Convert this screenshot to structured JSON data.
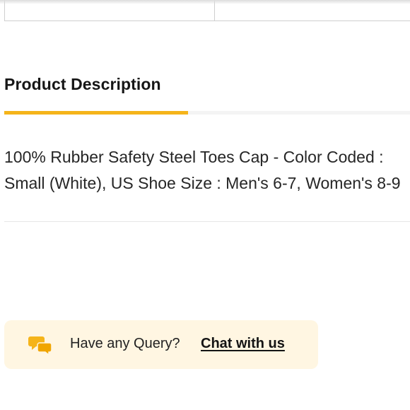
{
  "section": {
    "title": "Product Description"
  },
  "description": {
    "text": "100% Rubber Safety Steel Toes Cap - Color Coded : Small (White), US Shoe Size : Men's 6-7, Women's 8-9"
  },
  "query": {
    "prompt": "Have any Query?",
    "link_label": "Chat with us",
    "icon": "chat-bubbles-icon"
  },
  "colors": {
    "accent": "#f5b41a",
    "query_bg": "#fff6e2"
  }
}
